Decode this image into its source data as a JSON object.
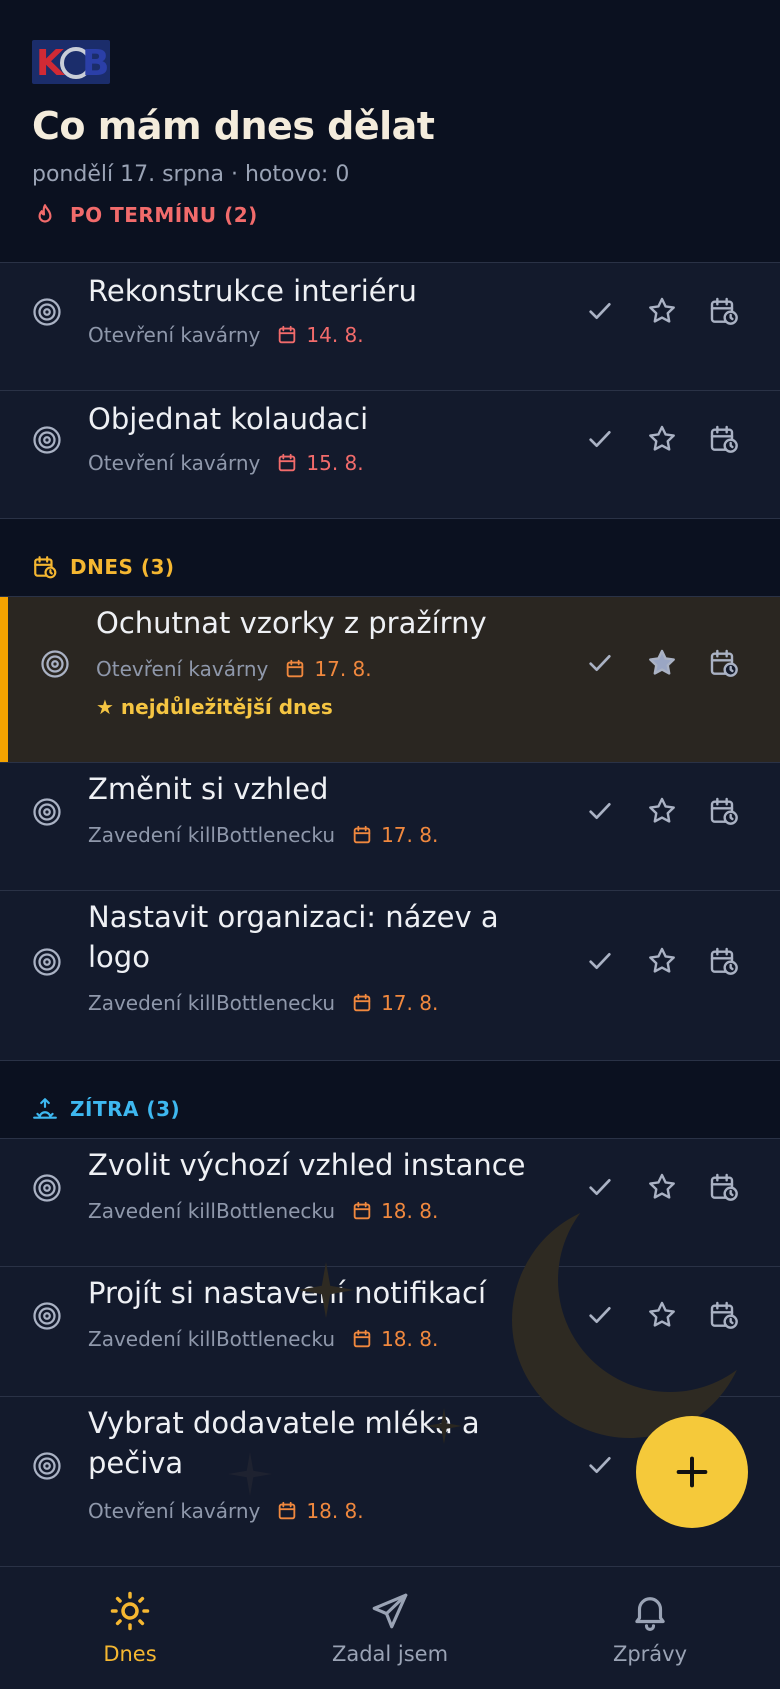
{
  "logo_text": "KOB",
  "header": {
    "title": "Co mám dnes dělat",
    "subtitle": "pondělí 17. srpna · hotovo: 0"
  },
  "colors": {
    "overdue": "#f26b6b",
    "today": "#f5b731",
    "tomorrow": "#3eb8f0",
    "date_today": "#f0883e",
    "accent": "#f5c93a"
  },
  "sections": [
    {
      "label": "PO TERMÍNU (2)",
      "icon": "fire-icon",
      "tasks": [
        {
          "title": "Rekonstrukce interiéru",
          "project": "Otevření kavárny",
          "date": "14. 8.",
          "starred": false
        },
        {
          "title": "Objednat kolaudaci",
          "project": "Otevření kavárny",
          "date": "15. 8.",
          "starred": false
        }
      ]
    },
    {
      "label": "DNES (3)",
      "icon": "calendar-clock-icon",
      "tasks": [
        {
          "title": "Ochutnat vzorky z pražírny",
          "project": "Otevření kavárny",
          "date": "17. 8.",
          "starred": true,
          "note": "★ nejdůležitější dnes"
        },
        {
          "title": "Změnit si vzhled",
          "project": "Zavedení killBottlenecku",
          "date": "17. 8.",
          "starred": false
        },
        {
          "title": "Nastavit organizaci: název a logo",
          "project": "Zavedení killBottlenecku",
          "date": "17. 8.",
          "starred": false
        }
      ]
    },
    {
      "label": "ZÍTRA (3)",
      "icon": "sunrise-icon",
      "tasks": [
        {
          "title": "Zvolit výchozí vzhled instance",
          "project": "Zavedení killBottlenecku",
          "date": "18. 8.",
          "starred": false
        },
        {
          "title": "Projít si nastavení notifikací",
          "project": "Zavedení killBottlenecku",
          "date": "18. 8.",
          "starred": false
        },
        {
          "title": "Vybrat dodavatele mléka a pečiva",
          "project": "Otevření kavárny",
          "date": "18. 8.",
          "starred": false
        }
      ]
    }
  ],
  "fab_icon": "plus-icon",
  "nav": [
    {
      "label": "Dnes",
      "icon": "sun-icon",
      "active": true
    },
    {
      "label": "Zadal jsem",
      "icon": "send-icon",
      "active": false
    },
    {
      "label": "Zprávy",
      "icon": "bell-icon",
      "active": false
    }
  ]
}
